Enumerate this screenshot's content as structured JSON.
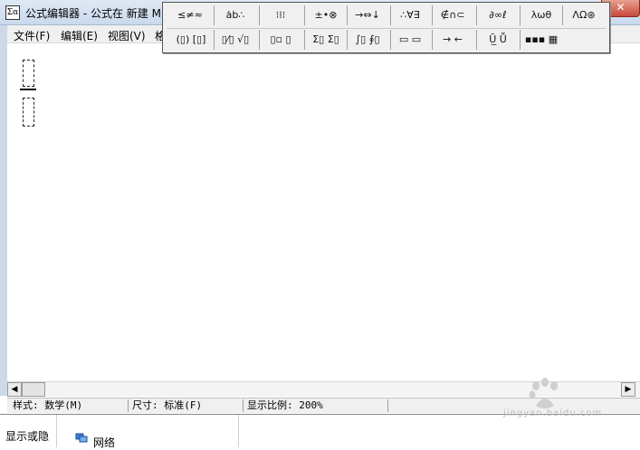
{
  "window": {
    "title": "公式编辑器 - 公式在 新建 M",
    "close_glyph": "✕"
  },
  "menu": {
    "items": [
      "文件(F)",
      "编辑(E)",
      "视图(V)",
      "格"
    ]
  },
  "palette": {
    "row1": [
      "≤≠≈",
      "ȧb∴",
      "⁝⁞⁝",
      "±•⊗",
      "→⇔↓",
      "∴∀∃",
      "∉∩⊂",
      "∂∞ℓ",
      "λωθ",
      "ΛΩ⊛"
    ],
    "row2": [
      "(▯) [▯]",
      "▯⁄▯ √▯",
      "▯▫ ▯",
      "Σ▯ Σ▯",
      "∫▯ ∮▯",
      "▭ ▭",
      "→ ←",
      "Ū̲ Ṻ",
      "▪▪▪ ▦"
    ]
  },
  "status": {
    "style": "样式: 数学(M)",
    "size": "尺寸: 标准(F)",
    "zoom": "显示比例: 200%"
  },
  "taskbar": {
    "left_label": "显示或隐",
    "network_label": "网络"
  },
  "scrollbar": {
    "left_arrow": "◀",
    "right_arrow": "▶"
  },
  "watermark": {
    "text": "jingyan.baidu.com"
  }
}
